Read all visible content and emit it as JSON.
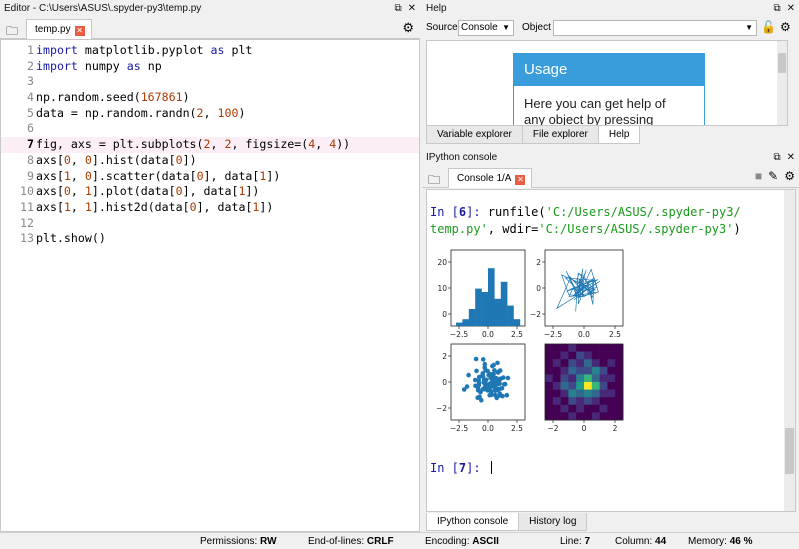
{
  "editor": {
    "title": "Editor - C:\\Users\\ASUS\\.spyder-py3\\temp.py",
    "tab_label": "temp.py",
    "lines": [
      {
        "n": "1",
        "tokens": [
          [
            "kw",
            "import"
          ],
          [
            "t",
            " matplotlib.pyplot "
          ],
          [
            "kw",
            "as"
          ],
          [
            "t",
            " plt"
          ]
        ]
      },
      {
        "n": "2",
        "tokens": [
          [
            "kw",
            "import"
          ],
          [
            "t",
            " numpy "
          ],
          [
            "kw",
            "as"
          ],
          [
            "t",
            " np"
          ]
        ]
      },
      {
        "n": "3",
        "tokens": []
      },
      {
        "n": "4",
        "tokens": [
          [
            "t",
            "np.random.seed("
          ],
          [
            "num",
            "167861"
          ],
          [
            "t",
            ")"
          ]
        ]
      },
      {
        "n": "5",
        "tokens": [
          [
            "t",
            "data = np.random.randn("
          ],
          [
            "num",
            "2"
          ],
          [
            "t",
            ", "
          ],
          [
            "num",
            "100"
          ],
          [
            "t",
            ")"
          ]
        ]
      },
      {
        "n": "6",
        "tokens": []
      },
      {
        "n": "7",
        "tokens": [
          [
            "t",
            "fig, axs = plt.subplots("
          ],
          [
            "num",
            "2"
          ],
          [
            "t",
            ", "
          ],
          [
            "num",
            "2"
          ],
          [
            "t",
            ", figsize=("
          ],
          [
            "num",
            "4"
          ],
          [
            "t",
            ", "
          ],
          [
            "num",
            "4"
          ],
          [
            "t",
            "))"
          ]
        ],
        "current": true
      },
      {
        "n": "8",
        "tokens": [
          [
            "t",
            "axs["
          ],
          [
            "num",
            "0"
          ],
          [
            "t",
            ", "
          ],
          [
            "num",
            "0"
          ],
          [
            "t",
            "].hist(data["
          ],
          [
            "num",
            "0"
          ],
          [
            "t",
            "])"
          ]
        ]
      },
      {
        "n": "9",
        "tokens": [
          [
            "t",
            "axs["
          ],
          [
            "num",
            "1"
          ],
          [
            "t",
            ", "
          ],
          [
            "num",
            "0"
          ],
          [
            "t",
            "].scatter(data["
          ],
          [
            "num",
            "0"
          ],
          [
            "t",
            "], data["
          ],
          [
            "num",
            "1"
          ],
          [
            "t",
            "])"
          ]
        ]
      },
      {
        "n": "10",
        "tokens": [
          [
            "t",
            "axs["
          ],
          [
            "num",
            "0"
          ],
          [
            "t",
            ", "
          ],
          [
            "num",
            "1"
          ],
          [
            "t",
            "].plot(data["
          ],
          [
            "num",
            "0"
          ],
          [
            "t",
            "], data["
          ],
          [
            "num",
            "1"
          ],
          [
            "t",
            "])"
          ]
        ]
      },
      {
        "n": "11",
        "tokens": [
          [
            "t",
            "axs["
          ],
          [
            "num",
            "1"
          ],
          [
            "t",
            ", "
          ],
          [
            "num",
            "1"
          ],
          [
            "t",
            "].hist2d(data["
          ],
          [
            "num",
            "0"
          ],
          [
            "t",
            "], data["
          ],
          [
            "num",
            "1"
          ],
          [
            "t",
            "])"
          ]
        ]
      },
      {
        "n": "12",
        "tokens": []
      },
      {
        "n": "13",
        "tokens": [
          [
            "t",
            "plt.show()"
          ]
        ]
      }
    ]
  },
  "help": {
    "title": "Help",
    "source_label": "Source",
    "source_value": "Console",
    "object_label": "Object",
    "usage_title": "Usage",
    "usage_text_1": "Here you can get help of",
    "usage_text_2": "any object by pressing",
    "tabs": [
      "Variable explorer",
      "File explorer",
      "Help"
    ]
  },
  "console": {
    "title": "IPython console",
    "tab_label": "Console 1/A",
    "in6_prompt": "In [",
    "in6_num": "6",
    "in6_close": "]: ",
    "cmd_prefix": "runfile(",
    "cmd_arg1_a": "'C:/Users/ASUS/.spyder-py3/",
    "cmd_arg1_b": "temp.py'",
    "cmd_mid": ", wdir=",
    "cmd_arg2": "'C:/Users/ASUS/.spyder-py3'",
    "cmd_end": ")",
    "in7_prompt": "In [",
    "in7_num": "7",
    "in7_close": "]: ",
    "tabs": [
      "IPython console",
      "History log"
    ]
  },
  "plot": {
    "hist_yticks": [
      "20",
      "10",
      "0"
    ],
    "hist_xticks": [
      "−2.5",
      "0.0",
      "2.5"
    ],
    "line_yticks": [
      "2",
      "0",
      "−2"
    ],
    "line_xticks": [
      "−2.5",
      "0.0",
      "2.5"
    ],
    "scatter_yticks": [
      "2",
      "0",
      "−2"
    ],
    "scatter_xticks": [
      "−2.5",
      "0.0",
      "2.5"
    ],
    "h2d_xticks": [
      "−2",
      "0",
      "2"
    ],
    "bar_color": "#1f77b4"
  },
  "statusbar": {
    "permissions_label": "Permissions:",
    "permissions_value": "RW",
    "eol_label": "End-of-lines:",
    "eol_value": "CRLF",
    "encoding_label": "Encoding:",
    "encoding_value": "ASCII",
    "line_label": "Line:",
    "line_value": "7",
    "column_label": "Column:",
    "column_value": "44",
    "memory_label": "Memory:",
    "memory_value": "46 %"
  }
}
